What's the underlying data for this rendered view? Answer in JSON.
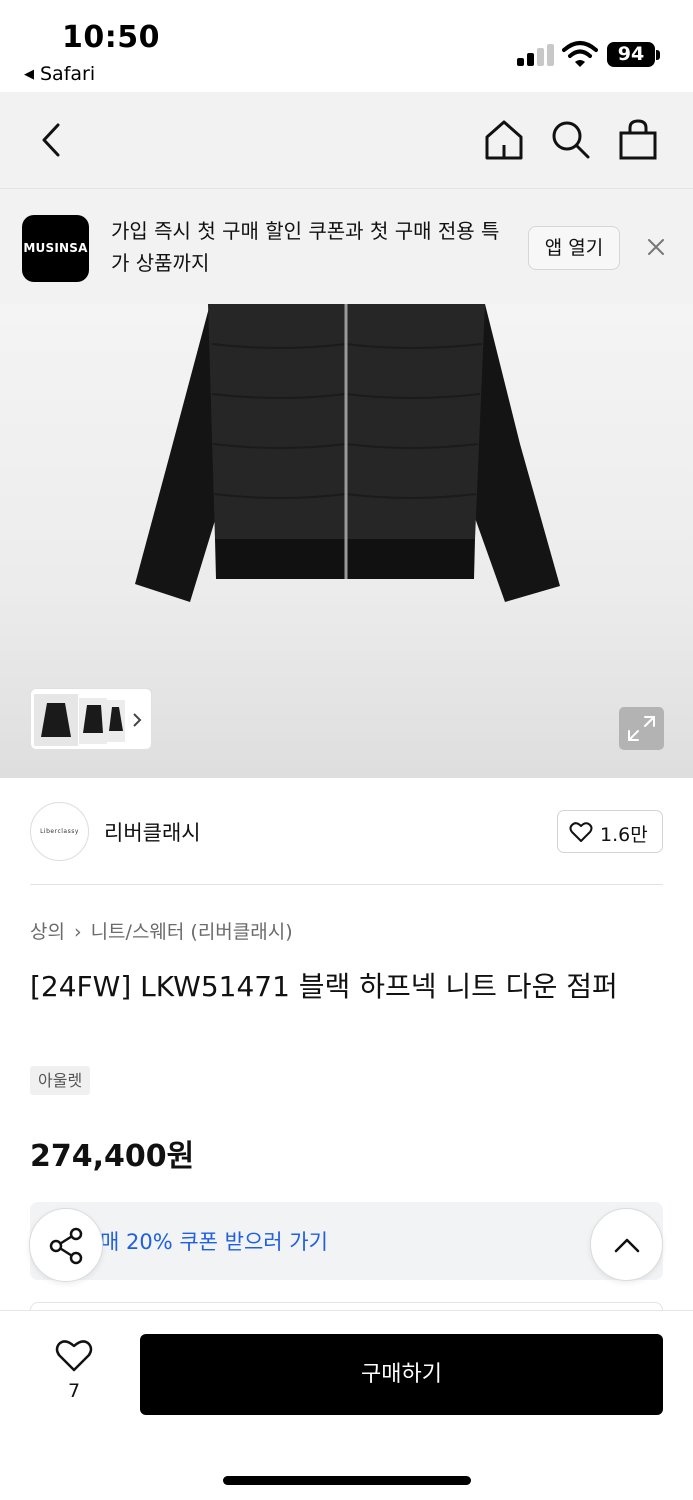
{
  "status_bar": {
    "time": "10:50",
    "back_app": "Safari",
    "battery": "94"
  },
  "nav": {
    "icons": [
      "back-icon",
      "home-icon",
      "search-icon",
      "shopping-bag-icon"
    ]
  },
  "app_banner": {
    "logo_text": "MUSINSA",
    "message": "가입 즉시 첫 구매 할인 쿠폰과 첫 구매 전용 특가 상품까지",
    "open_app_label": "앱 열기"
  },
  "brand": {
    "logo_text": "Liberclassy",
    "name": "리버클래시",
    "like_count": "1.6만"
  },
  "breadcrumb": {
    "category": "상의",
    "subcategory": "니트/스웨터 (리버클래시)"
  },
  "product": {
    "title": "[24FW] LKW51471 블랙 하프넥 니트 다운 점퍼",
    "badge": "아울렛",
    "price": "274,400원",
    "coupon_text": "매 20% 쿠폰 받으러 가기"
  },
  "bottom_bar": {
    "like_count": "7",
    "buy_label": "구매하기"
  }
}
